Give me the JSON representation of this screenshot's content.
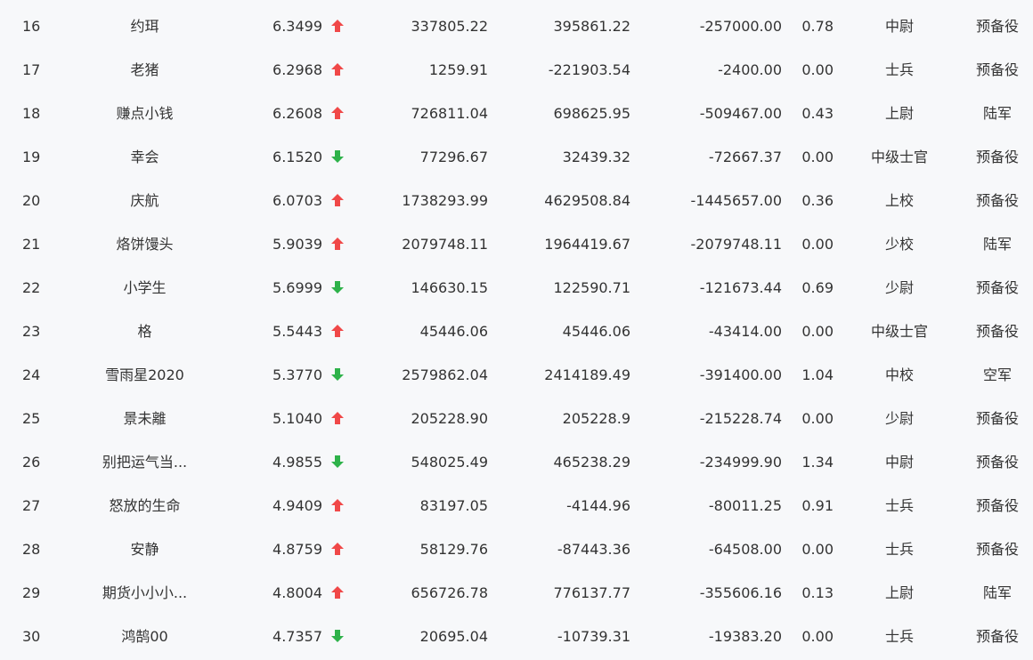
{
  "colors": {
    "up": "#f04848",
    "down": "#2eb24a",
    "text": "#333333",
    "background": "#f7f8fa"
  },
  "rows": [
    {
      "rank": "16",
      "name": "约珥",
      "score": "6.3499",
      "trend": "up",
      "a": "337805.22",
      "b": "395861.22",
      "c": "-257000.00",
      "d": "0.78",
      "title": "中尉",
      "branch": "预备役"
    },
    {
      "rank": "17",
      "name": "老猪",
      "score": "6.2968",
      "trend": "up",
      "a": "1259.91",
      "b": "-221903.54",
      "c": "-2400.00",
      "d": "0.00",
      "title": "士兵",
      "branch": "预备役"
    },
    {
      "rank": "18",
      "name": "赚点小钱",
      "score": "6.2608",
      "trend": "up",
      "a": "726811.04",
      "b": "698625.95",
      "c": "-509467.00",
      "d": "0.43",
      "title": "上尉",
      "branch": "陆军"
    },
    {
      "rank": "19",
      "name": "幸会",
      "score": "6.1520",
      "trend": "down",
      "a": "77296.67",
      "b": "32439.32",
      "c": "-72667.37",
      "d": "0.00",
      "title": "中级士官",
      "branch": "预备役"
    },
    {
      "rank": "20",
      "name": "庆航",
      "score": "6.0703",
      "trend": "up",
      "a": "1738293.99",
      "b": "4629508.84",
      "c": "-1445657.00",
      "d": "0.36",
      "title": "上校",
      "branch": "预备役"
    },
    {
      "rank": "21",
      "name": "烙饼馒头",
      "score": "5.9039",
      "trend": "up",
      "a": "2079748.11",
      "b": "1964419.67",
      "c": "-2079748.11",
      "d": "0.00",
      "title": "少校",
      "branch": "陆军"
    },
    {
      "rank": "22",
      "name": "小学生",
      "score": "5.6999",
      "trend": "down",
      "a": "146630.15",
      "b": "122590.71",
      "c": "-121673.44",
      "d": "0.69",
      "title": "少尉",
      "branch": "预备役"
    },
    {
      "rank": "23",
      "name": "格",
      "score": "5.5443",
      "trend": "up",
      "a": "45446.06",
      "b": "45446.06",
      "c": "-43414.00",
      "d": "0.00",
      "title": "中级士官",
      "branch": "预备役"
    },
    {
      "rank": "24",
      "name": "雪雨星2020",
      "score": "5.3770",
      "trend": "down",
      "a": "2579862.04",
      "b": "2414189.49",
      "c": "-391400.00",
      "d": "1.04",
      "title": "中校",
      "branch": "空军"
    },
    {
      "rank": "25",
      "name": "景未離",
      "score": "5.1040",
      "trend": "up",
      "a": "205228.90",
      "b": "205228.9",
      "c": "-215228.74",
      "d": "0.00",
      "title": "少尉",
      "branch": "预备役"
    },
    {
      "rank": "26",
      "name": "别把运气当...",
      "score": "4.9855",
      "trend": "down",
      "a": "548025.49",
      "b": "465238.29",
      "c": "-234999.90",
      "d": "1.34",
      "title": "中尉",
      "branch": "预备役"
    },
    {
      "rank": "27",
      "name": "怒放的生命",
      "score": "4.9409",
      "trend": "up",
      "a": "83197.05",
      "b": "-4144.96",
      "c": "-80011.25",
      "d": "0.91",
      "title": "士兵",
      "branch": "预备役"
    },
    {
      "rank": "28",
      "name": "安静",
      "score": "4.8759",
      "trend": "up",
      "a": "58129.76",
      "b": "-87443.36",
      "c": "-64508.00",
      "d": "0.00",
      "title": "士兵",
      "branch": "预备役"
    },
    {
      "rank": "29",
      "name": "期货小小小...",
      "score": "4.8004",
      "trend": "up",
      "a": "656726.78",
      "b": "776137.77",
      "c": "-355606.16",
      "d": "0.13",
      "title": "上尉",
      "branch": "陆军"
    },
    {
      "rank": "30",
      "name": "鸿鹄00",
      "score": "4.7357",
      "trend": "down",
      "a": "20695.04",
      "b": "-10739.31",
      "c": "-19383.20",
      "d": "0.00",
      "title": "士兵",
      "branch": "预备役"
    }
  ]
}
